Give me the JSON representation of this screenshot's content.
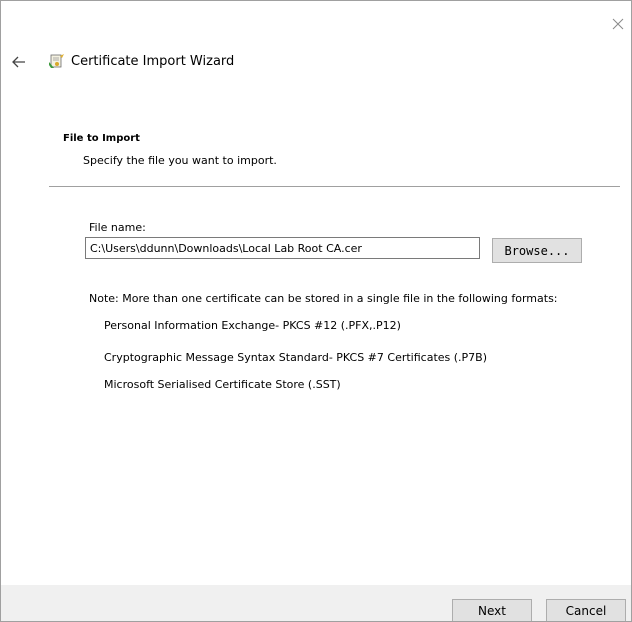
{
  "window": {
    "title": "Certificate Import Wizard",
    "icons": {
      "close": "close-icon",
      "back": "back-arrow-icon",
      "wizard": "certificate-wizard-icon"
    }
  },
  "page": {
    "heading": "File to Import",
    "subheading": "Specify the file you want to import."
  },
  "file": {
    "label": "File name:",
    "value": "C:\\Users\\ddunn\\Downloads\\Local Lab Root CA.cer",
    "browse_label": "Browse..."
  },
  "note": {
    "text": "Note:  More than one certificate can be stored in a single file in the following formats:",
    "formats": [
      "Personal Information Exchange- PKCS #12 (.PFX,.P12)",
      "Cryptographic Message Syntax Standard- PKCS #7 Certificates (.P7B)",
      "Microsoft Serialised Certificate Store (.SST)"
    ]
  },
  "footer": {
    "next_label": "Next",
    "cancel_label": "Cancel"
  },
  "colors": {
    "divider": "#a0a0a0",
    "footer_bg": "#f0f0f0",
    "button_bg": "#e1e1e1",
    "button_border": "#adadad"
  }
}
